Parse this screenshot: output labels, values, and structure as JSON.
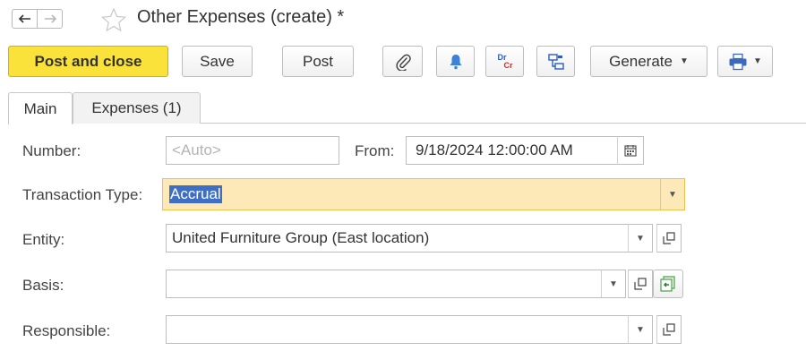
{
  "window": {
    "title": "Other Expenses (create) *"
  },
  "toolbar": {
    "post_and_close": "Post and close",
    "save": "Save",
    "post": "Post",
    "dr_label": "Dr",
    "cr_label": "Cr",
    "generate": "Generate",
    "icons": [
      "back-arrow-icon",
      "forward-arrow-icon",
      "favorite-star-icon",
      "paperclip-icon",
      "bell-icon",
      "dr-cr-icon",
      "structure-icon",
      "printer-icon"
    ]
  },
  "tabs": [
    {
      "label": "Main",
      "active": true
    },
    {
      "label": "Expenses (1)",
      "active": false
    }
  ],
  "form": {
    "number": {
      "label": "Number:",
      "placeholder": "<Auto>"
    },
    "from": {
      "label": "From:",
      "value": "9/18/2024 12:00:00 AM"
    },
    "transaction_type": {
      "label": "Transaction Type:",
      "value": "Accrual"
    },
    "entity": {
      "label": "Entity:",
      "value": "United Furniture Group (East location)"
    },
    "basis": {
      "label": "Basis:",
      "value": ""
    },
    "responsible": {
      "label": "Responsible:",
      "value": ""
    }
  },
  "colors": {
    "primary_button": "#fbe23a",
    "highlight_field": "#fde8b7",
    "selection": "#3f6fc4"
  }
}
